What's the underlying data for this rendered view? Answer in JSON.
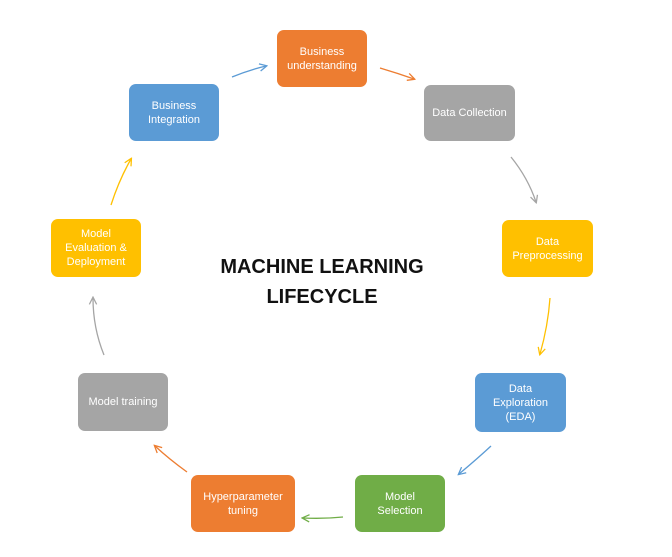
{
  "title": {
    "line1": "MACHINE LEARNING",
    "line2": "LIFECYCLE"
  },
  "nodes": [
    {
      "id": "business-understanding",
      "label": "Business\nunderstanding",
      "color": "#ED7D31"
    },
    {
      "id": "data-collection",
      "label": "Data Collection",
      "color": "#A5A5A5"
    },
    {
      "id": "data-preprocessing",
      "label": "Data\nPreprocessing",
      "color": "#FFC000"
    },
    {
      "id": "data-exploration",
      "label": "Data\nExploration\n(EDA)",
      "color": "#5B9BD5"
    },
    {
      "id": "model-selection",
      "label": "Model\nSelection",
      "color": "#70AD47"
    },
    {
      "id": "hyperparameter-tuning",
      "label": "Hyperparameter\ntuning",
      "color": "#ED7D31"
    },
    {
      "id": "model-training",
      "label": "Model training",
      "color": "#A5A5A5"
    },
    {
      "id": "model-evaluation",
      "label": "Model\nEvaluation &\nDeployment",
      "color": "#FFC000"
    },
    {
      "id": "business-integration",
      "label": "Business\nIntegration",
      "color": "#5B9BD5"
    }
  ],
  "arrows": [
    {
      "id": "business-understanding-to-data-collection",
      "color": "#ED7D31"
    },
    {
      "id": "data-collection-to-data-preprocessing",
      "color": "#A5A5A5"
    },
    {
      "id": "data-preprocessing-to-data-exploration",
      "color": "#FFC000"
    },
    {
      "id": "data-exploration-to-model-selection",
      "color": "#5B9BD5"
    },
    {
      "id": "model-selection-to-hyperparameter-tuning",
      "color": "#70AD47"
    },
    {
      "id": "hyperparameter-tuning-to-model-training",
      "color": "#ED7D31"
    },
    {
      "id": "model-training-to-model-evaluation",
      "color": "#A5A5A5"
    },
    {
      "id": "model-evaluation-to-business-integration",
      "color": "#FFC000"
    },
    {
      "id": "business-integration-to-business-understanding",
      "color": "#5B9BD5"
    }
  ]
}
